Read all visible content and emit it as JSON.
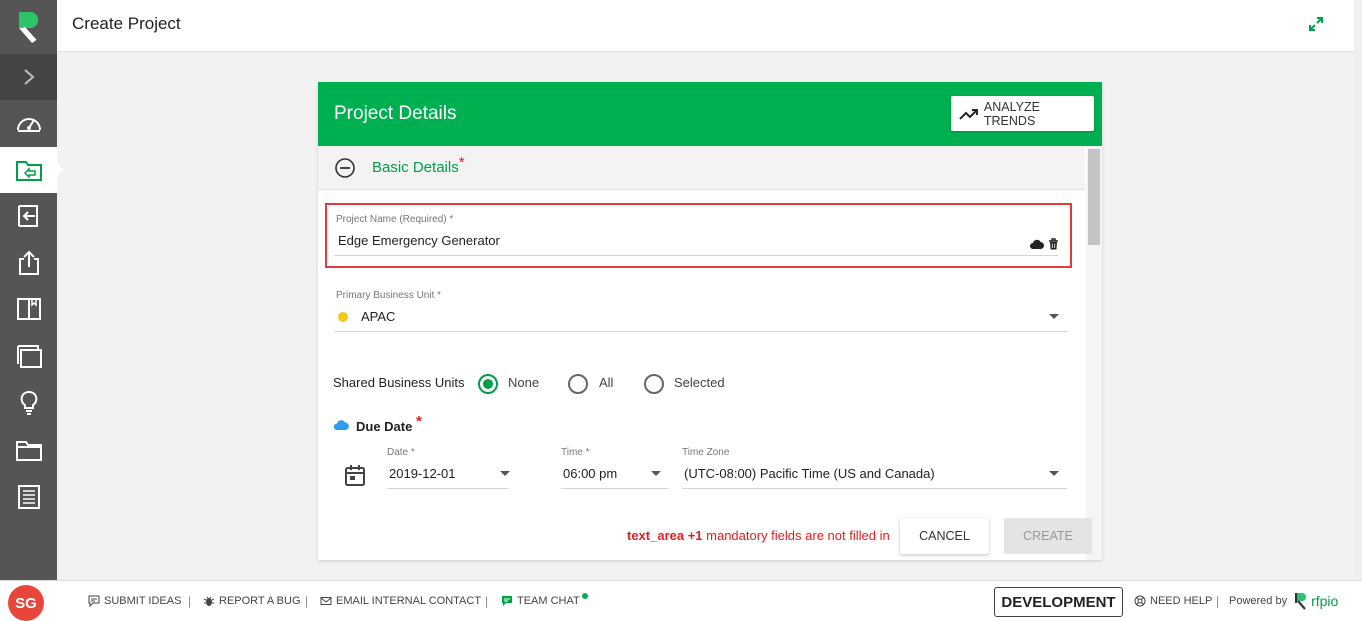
{
  "header": {
    "title": "Create Project"
  },
  "sidebar": {
    "items": [
      {
        "icon": "dashboard-icon"
      },
      {
        "icon": "projects-icon",
        "active": true
      },
      {
        "icon": "import-icon"
      },
      {
        "icon": "export-icon"
      },
      {
        "icon": "library-icon"
      },
      {
        "icon": "documents-icon"
      },
      {
        "icon": "ideas-icon"
      },
      {
        "icon": "folder-icon"
      },
      {
        "icon": "reports-icon"
      }
    ]
  },
  "card": {
    "title": "Project Details",
    "analyze_label": "ANALYZE TRENDS",
    "section_title": "Basic Details",
    "required_mark": "*",
    "project_name": {
      "label": "Project Name (Required) *",
      "value": "Edge Emergency Generator"
    },
    "business_unit": {
      "label": "Primary Business Unit *",
      "value": "APAC",
      "dot_color": "#f2c81a"
    },
    "shared_units": {
      "label": "Shared Business Units",
      "options": [
        "None",
        "All",
        "Selected"
      ],
      "selected": "None"
    },
    "due_date": {
      "label": "Due Date",
      "date": {
        "label": "Date *",
        "value": "2019-12-01"
      },
      "time": {
        "label": "Time *",
        "value": "06:00 pm"
      },
      "timezone": {
        "label": "Time Zone",
        "value": "(UTC-08:00) Pacific Time (US and Canada)"
      }
    },
    "error": {
      "field": "text_area +1",
      "message": " mandatory fields are not filled in"
    },
    "cancel_label": "CANCEL",
    "create_label": "CREATE"
  },
  "footer": {
    "avatar": "SG",
    "submit_ideas": "SUBMIT IDEAS",
    "report_bug": "REPORT A BUG",
    "email_contact": "EMAIL INTERNAL CONTACT",
    "team_chat": "TEAM CHAT",
    "environment": "DEVELOPMENT",
    "need_help": "NEED HELP",
    "powered_by": "Powered by",
    "brand": "rfpio",
    "separator": "|"
  },
  "colors": {
    "accent": "#00b050",
    "error": "#e02020",
    "sidebar": "#555555"
  }
}
